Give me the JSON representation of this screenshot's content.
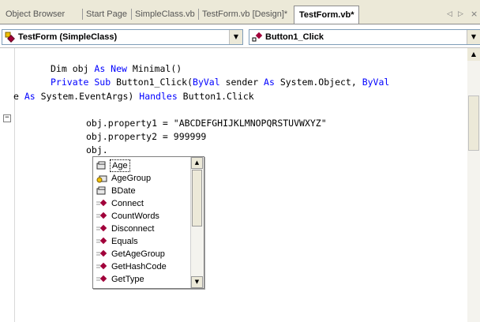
{
  "tabs": [
    {
      "label": "Object Browser",
      "active": false
    },
    {
      "label": "Start Page",
      "active": false
    },
    {
      "label": "SimpleClass.vb",
      "active": false
    },
    {
      "label": "TestForm.vb [Design]*",
      "active": false
    },
    {
      "label": "TestForm.vb*",
      "active": true
    }
  ],
  "tab_nav": {
    "prev": "◁",
    "next": "▷",
    "close": "×"
  },
  "navbar": {
    "class_combo": "TestForm (SimpleClass)",
    "method_combo": "Button1_Click"
  },
  "code": {
    "line1_a": "Dim obj ",
    "line1_kw": "As New",
    "line1_b": " Minimal()",
    "line2_kw1": "Private Sub",
    "line2_a": " Button1_Click(",
    "line2_kw2": "ByVal",
    "line2_b": " sender ",
    "line2_kw3": "As",
    "line2_c": " System.Object, ",
    "line2_kw4": "ByVal",
    "line3_a": "e ",
    "line3_kw1": "As",
    "line3_b": " System.EventArgs) ",
    "line3_kw2": "Handles",
    "line3_c": " Button1.Click",
    "line4": "obj.property1 = \"ABCDEFGHIJKLMNOPQRSTUVWXYZ\"",
    "line5": "obj.property2 = 999999",
    "line6": "obj."
  },
  "intellisense": {
    "items": [
      {
        "label": "Age",
        "icon": "property-icon",
        "selected": true
      },
      {
        "label": "AgeGroup",
        "icon": "property-key-icon"
      },
      {
        "label": "BDate",
        "icon": "property-icon"
      },
      {
        "label": "Connect",
        "icon": "method-icon"
      },
      {
        "label": "CountWords",
        "icon": "method-icon"
      },
      {
        "label": "Disconnect",
        "icon": "method-icon"
      },
      {
        "label": "Equals",
        "icon": "method-icon"
      },
      {
        "label": "GetAgeGroup",
        "icon": "method-icon"
      },
      {
        "label": "GetHashCode",
        "icon": "method-icon"
      },
      {
        "label": "GetType",
        "icon": "method-icon"
      }
    ]
  },
  "colors": {
    "keyword": "#0000ff",
    "method_icon": "#a1003a"
  }
}
